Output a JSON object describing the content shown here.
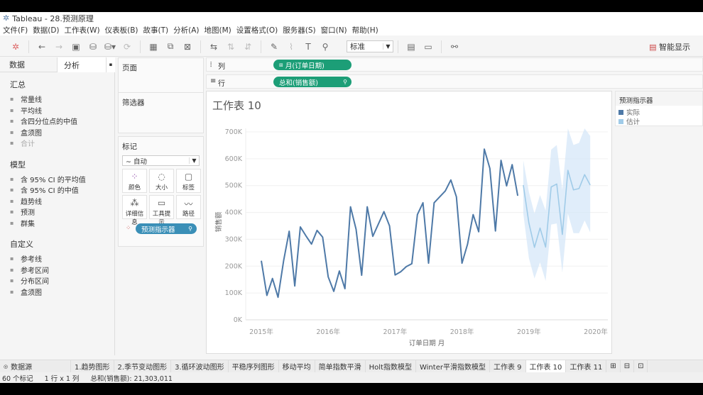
{
  "window": {
    "title": "Tableau - 28.预测原理"
  },
  "menu": [
    "文件(F)",
    "数据(D)",
    "工作表(W)",
    "仪表板(B)",
    "故事(T)",
    "分析(A)",
    "地图(M)",
    "设置格式(O)",
    "服务器(S)",
    "窗口(N)",
    "帮助(H)"
  ],
  "toolbar": {
    "fit_select": "标准",
    "show_me": "智能显示"
  },
  "left_pane": {
    "tabs": [
      "数据",
      "分析"
    ],
    "sections": [
      {
        "title": "汇总",
        "items": [
          "常量线",
          "平均线",
          "含四分位点的中值",
          "盒须图",
          "合计"
        ]
      },
      {
        "title": "模型",
        "items": [
          "含 95% CI 的平均值",
          "含 95% CI 的中值",
          "趋势线",
          "预测",
          "群集"
        ]
      },
      {
        "title": "自定义",
        "items": [
          "参考线",
          "参考区间",
          "分布区间",
          "盒须图"
        ]
      }
    ]
  },
  "cards": {
    "pages": "页面",
    "filters": "筛选器",
    "marks": {
      "title": "标记",
      "type": "自动",
      "buttons": [
        "颜色",
        "大小",
        "标签",
        "详细信息",
        "工具提示",
        "路径"
      ],
      "color_pill": "预测指示器"
    }
  },
  "shelves": {
    "columns_label": "列",
    "columns_pill": "月(订单日期)",
    "rows_label": "行",
    "rows_pill": "总和(销售额)"
  },
  "legend": {
    "title": "预测指示器",
    "items": [
      {
        "label": "实际",
        "color": "#4e79a7"
      },
      {
        "label": "估计",
        "color": "#a0cbe8"
      }
    ]
  },
  "sheet_tabs": {
    "datasource": "数据源",
    "tabs": [
      "1.趋势图形",
      "2.季节变动图形",
      "3.循环波动图形",
      "平稳序列图形",
      "移动平均",
      "简单指数平滑",
      "Holt指数模型",
      "Winter平滑指数模型",
      "工作表 9",
      "工作表 10",
      "工作表 11"
    ],
    "active": "工作表 10"
  },
  "status": {
    "marks": "60 个标记",
    "rows_cols": "1 行 x 1 列",
    "sum": "总和(销售额): 21,303,011"
  },
  "chart_data": {
    "type": "line",
    "title": "工作表 10",
    "xlabel": "订单日期 月",
    "ylabel": "销售额",
    "ylim": [
      0,
      700000
    ],
    "yticks": [
      "0K",
      "100K",
      "200K",
      "300K",
      "400K",
      "500K",
      "600K",
      "700K"
    ],
    "xticks": [
      "2015年",
      "2016年",
      "2017年",
      "2018年",
      "2019年",
      "2020年"
    ],
    "x_start": "2015-01",
    "grid": true,
    "series": [
      {
        "name": "实际",
        "color": "#4e79a7",
        "start": "2015-01",
        "values": [
          220000,
          91000,
          154000,
          84000,
          220000,
          330000,
          126000,
          346000,
          313000,
          282000,
          333000,
          308000,
          160000,
          106000,
          182000,
          116000,
          421000,
          337000,
          166000,
          421000,
          311000,
          357000,
          403000,
          350000,
          167000,
          179000,
          198000,
          209000,
          392000,
          436000,
          211000,
          436000,
          458000,
          480000,
          521000,
          458000,
          211000,
          282000,
          392000,
          328000,
          636000,
          564000,
          331000,
          594000,
          499000,
          578000,
          462000
        ]
      },
      {
        "name": "估计",
        "color": "#a0cbe8",
        "start": "2018-12",
        "values": [
          502000,
          361000,
          270000,
          342000,
          271000,
          495000,
          506000,
          318000,
          557000,
          484000,
          489000,
          541000,
          502000
        ],
        "upper": [
          594000,
          476000,
          396000,
          465000,
          407000,
          634000,
          651000,
          484000,
          713000,
          651000,
          659000,
          713000,
          685000
        ],
        "lower": [
          396000,
          230000,
          154000,
          214000,
          145000,
          355000,
          359000,
          176000,
          396000,
          323000,
          323000,
          370000,
          326000
        ]
      }
    ]
  }
}
